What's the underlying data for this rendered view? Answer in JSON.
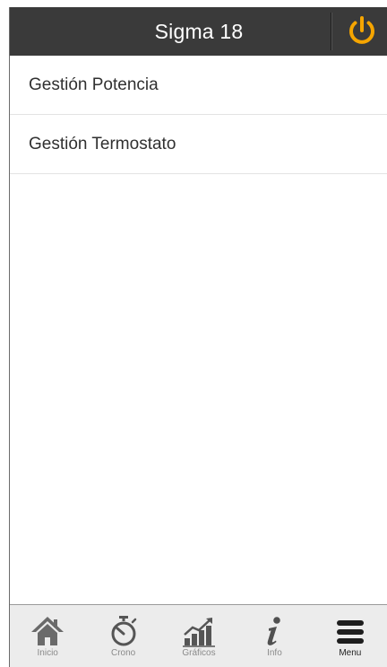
{
  "header": {
    "title": "Sigma 18",
    "power_icon": "power-icon",
    "background": "#3a3a3a",
    "accent": "#f5a500"
  },
  "menu": {
    "items": [
      {
        "label": "Gestión Potencia"
      },
      {
        "label": "Gestión Termostato"
      }
    ]
  },
  "tabbar": {
    "tabs": [
      {
        "label": "Inicio",
        "icon": "home-icon"
      },
      {
        "label": "Crono",
        "icon": "stopwatch-icon"
      },
      {
        "label": "Gráficos",
        "icon": "bar-chart-icon"
      },
      {
        "label": "Info",
        "icon": "info-icon"
      },
      {
        "label": "Menu",
        "icon": "hamburger-menu-icon",
        "active": true
      }
    ]
  }
}
